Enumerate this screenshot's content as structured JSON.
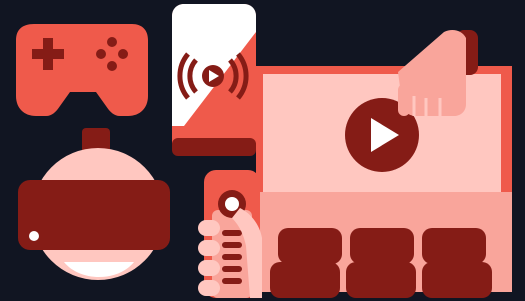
{
  "illustration": {
    "subject": "media-and-entertainment",
    "icons": [
      "gamepad-icon",
      "smartphone-broadcast-icon",
      "vr-headset-icon",
      "remote-control-icon",
      "video-screen-play-icon",
      "cinema-seats-icon"
    ],
    "colors": {
      "background": "#111522",
      "dark_red": "#851c16",
      "mid_red": "#ef5a4b",
      "light_pink": "#f9a59b",
      "pale_pink": "#ffc7c0",
      "white": "#ffffff"
    }
  }
}
